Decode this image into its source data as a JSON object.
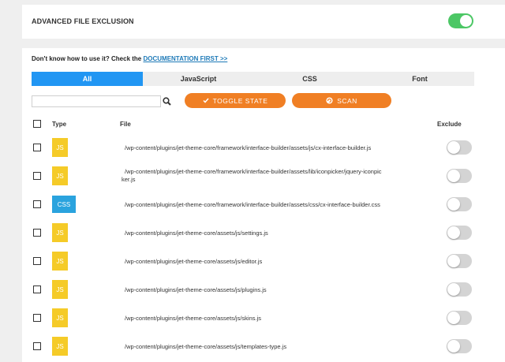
{
  "header": {
    "title": "ADVANCED FILE EXCLUSION",
    "toggle_on": true,
    "toggle_color": "#4cc765"
  },
  "doc": {
    "prefix": "Don't know how to use it? Check the ",
    "link": "DOCUMENTATION FIRST >>"
  },
  "tabs": [
    {
      "label": "All",
      "active": true
    },
    {
      "label": "JavaScript",
      "active": false
    },
    {
      "label": "CSS",
      "active": false
    },
    {
      "label": "Font",
      "active": false
    }
  ],
  "search": {
    "value": "",
    "placeholder": "",
    "icon": "search-icon"
  },
  "buttons": {
    "toggle_state": {
      "label": "TOGGLE STATE",
      "icon": "check-icon"
    },
    "scan": {
      "label": "SCAN",
      "icon": "refresh-icon"
    },
    "color": "#f07f24"
  },
  "columns": {
    "type": "Type",
    "file": "File",
    "exclude": "Exclude"
  },
  "rows": [
    {
      "type": "JS",
      "path": "/wp-content/plugins/jet-theme-core/framework/interface-builder/assets/js/cx-interface-builder.js",
      "excluded": false
    },
    {
      "type": "JS",
      "path_line1": "/wp-content/plugins/jet-theme-core/framework/interface-builder/assets/lib/iconpicker/jquery-iconpic",
      "path_line2": "ker.js",
      "excluded": false
    },
    {
      "type": "CSS",
      "path": "/wp-content/plugins/jet-theme-core/framework/interface-builder/assets/css/cx-interface-builder.css",
      "excluded": false
    },
    {
      "type": "JS",
      "path": "/wp-content/plugins/jet-theme-core/assets/js/settings.js",
      "excluded": false
    },
    {
      "type": "JS",
      "path": "/wp-content/plugins/jet-theme-core/assets/js/editor.js",
      "excluded": false
    },
    {
      "type": "JS",
      "path": "/wp-content/plugins/jet-theme-core/assets/js/plugins.js",
      "excluded": false
    },
    {
      "type": "JS",
      "path": "/wp-content/plugins/jet-theme-core/assets/js/skins.js",
      "excluded": false
    },
    {
      "type": "JS",
      "path": "/wp-content/plugins/jet-theme-core/assets/js/templates-type.js",
      "excluded": false
    }
  ],
  "colors": {
    "js_badge": "#f5cb28",
    "css_badge": "#2aa3de",
    "active_tab": "#2196f3"
  }
}
